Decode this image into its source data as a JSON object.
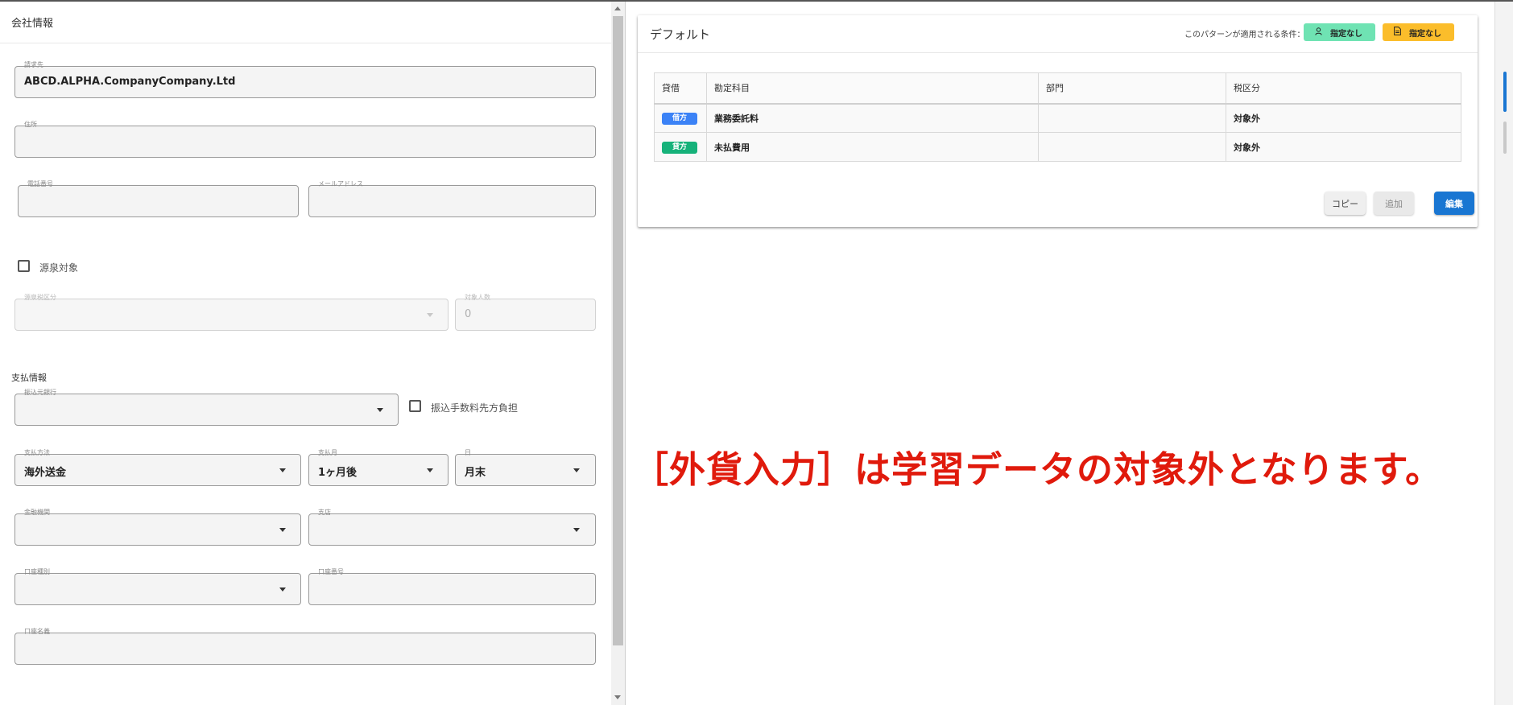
{
  "left": {
    "company_section_title": "会社情報",
    "fields": {
      "billing_to": {
        "label": "請求先",
        "value": "ABCD.ALPHA.CompanyCompany.Ltd"
      },
      "address": {
        "label": "住所",
        "value": ""
      },
      "phone": {
        "label": "電話番号",
        "value": ""
      },
      "email": {
        "label": "メールアドレス",
        "value": ""
      },
      "withholding_category": {
        "label": "源泉税区分",
        "value": ""
      },
      "target_persons": {
        "label": "対象人数",
        "value": "0"
      },
      "transfer_bank": {
        "label": "振込元銀行",
        "value": ""
      },
      "payment_method": {
        "label": "支払方法",
        "value": "海外送金"
      },
      "payment_month": {
        "label": "支払月",
        "value": "1ヶ月後"
      },
      "payment_day": {
        "label": "日",
        "value": "月末"
      },
      "financial_institution": {
        "label": "金融機関",
        "value": ""
      },
      "branch": {
        "label": "支店",
        "value": ""
      },
      "account_type": {
        "label": "口座種別",
        "value": ""
      },
      "account_number": {
        "label": "口座番号",
        "value": ""
      },
      "account_name": {
        "label": "口座名義",
        "value": ""
      }
    },
    "withholding_checkbox_label": "源泉対象",
    "fee_checkbox_label": "振込手数料先方負担",
    "payment_section_title": "支払情報"
  },
  "right": {
    "card_title": "デフォルト",
    "condition_label": "このパターンが適用される条件：",
    "badges": [
      {
        "icon": "person-icon",
        "label": "指定なし",
        "color": "#6fe3b3"
      },
      {
        "icon": "document-icon",
        "label": "指定なし",
        "color": "#fbbd2b"
      }
    ],
    "table": {
      "headers": [
        "貸借",
        "勘定科目",
        "部門",
        "税区分"
      ],
      "rows": [
        {
          "side": "借方",
          "side_color": "#3b82f6",
          "account": "業務委託料",
          "department": "",
          "tax": "対象外"
        },
        {
          "side": "貸方",
          "side_color": "#16b27a",
          "account": "未払費用",
          "department": "",
          "tax": "対象外"
        }
      ]
    },
    "buttons": {
      "copy": "コピー",
      "add": "追加",
      "edit": "編集"
    },
    "annotation": "［外貨入力］は学習データの対象外となります。",
    "annotation_color": "#e01a0c"
  }
}
